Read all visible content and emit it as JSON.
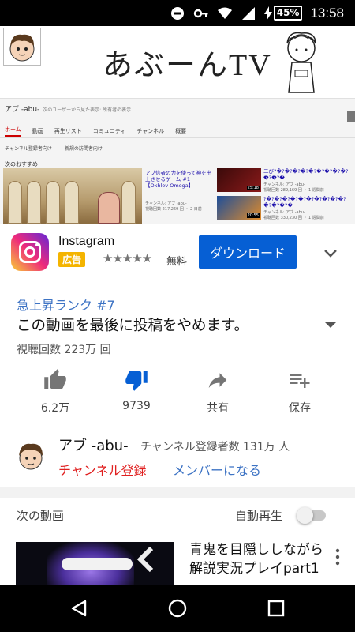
{
  "status_bar": {
    "battery": "45%",
    "time": "13:58"
  },
  "player": {
    "banner_title": "あぶーんTV",
    "banner_char_caption": "あぶーん",
    "channel_name": "アブ -abu-",
    "channel_sub": "次のユーザーから見た表示: 所有者の表示",
    "tabs": [
      "ホーム",
      "動画",
      "再生リスト",
      "コミュニティ",
      "チャンネル",
      "概要"
    ],
    "subtabs": [
      "チャンネル登録者向け",
      "新規の訪問者向け"
    ],
    "section_label": "次のおすすめ",
    "mid_title": "アブ信者の力を使って神を出上させるゲーム #1【Okhlev Omega】",
    "mid_meta": "チャンネル: アブ -abu-\n視聴回数 217,269 回 ・ 2 日前",
    "items": [
      {
        "duration": "25:18",
        "title": "二び?�?�?�?�?�?�?�?�?�?�?�?�",
        "meta": "チャンネル: アブ -abu-\n視聴回数 289,169 回 ・ 1 週間前"
      },
      {
        "duration": "20:55",
        "title": "?�?�?�?�?�?�?�?�?�?�?�?�?�?�",
        "meta": "チャンネル: アブ -abu-\n視聴回数 330,230 回 ・ 1 週間前"
      }
    ]
  },
  "ad": {
    "app_name": "Instagram",
    "badge": "広告",
    "stars": "★★★★★",
    "rating": 4.5,
    "price": "無料",
    "download_label": "ダウンロード"
  },
  "video": {
    "trending": "急上昇ランク #7",
    "title": "この動画を最後に投稿をやめます。",
    "views": "視聴回数 223万 回",
    "actions": [
      {
        "label": "6.2万"
      },
      {
        "label": "9739"
      },
      {
        "label": "共有"
      },
      {
        "label": "保存"
      }
    ]
  },
  "channel": {
    "name": "アブ -abu-",
    "subscribers": "チャンネル登録者数 131万 人",
    "subscribe_label": "チャンネル登録",
    "member_label": "メンバーになる"
  },
  "up_next": {
    "label": "次の動画",
    "autoplay_label": "自動再生",
    "autoplay_on": false,
    "title": "青鬼を目隠ししながら解説実況プレイpart1"
  },
  "colors": {
    "accent_blue": "#065fd4",
    "link_blue": "#3d73c4",
    "subscribe_red": "#e01f1f",
    "ad_badge": "#f4b400",
    "dislike_active": "#065fd4"
  }
}
